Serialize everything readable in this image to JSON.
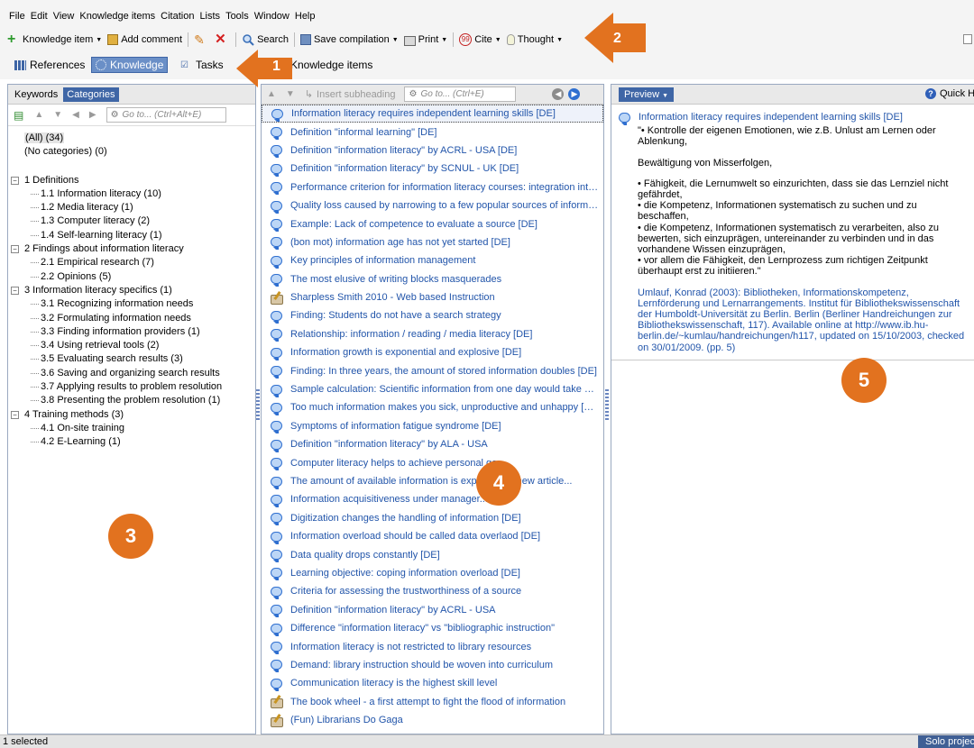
{
  "menu": [
    "File",
    "Edit",
    "View",
    "Knowledge items",
    "Citation",
    "Lists",
    "Tools",
    "Window",
    "Help"
  ],
  "toolbar": {
    "knowledge_item": "Knowledge item",
    "add_comment": "Add comment",
    "search": "Search",
    "save_compilation": "Save compilation",
    "print": "Print",
    "cite": "Cite",
    "thought": "Thought"
  },
  "nav": {
    "references": "References",
    "knowledge": "Knowledge",
    "tasks": "Tasks",
    "pane_title": "Knowledge items"
  },
  "left": {
    "tabs": [
      "Keywords",
      "Categories"
    ],
    "goto_placeholder": "Go to... (Ctrl+Alt+E)",
    "all": "(All) (34)",
    "none": "(No categories) (0)",
    "groups": [
      {
        "label": "1 Definitions",
        "items": [
          "1.1 Information literacy (10)",
          "1.2 Media literacy (1)",
          "1.3 Computer literacy (2)",
          "1.4 Self-learning literacy (1)"
        ]
      },
      {
        "label": "2 Findings about information literacy",
        "items": [
          "2.1 Empirical research (7)",
          "2.2 Opinions (5)"
        ]
      },
      {
        "label": "3 Information literacy specifics (1)",
        "items": [
          "3.1 Recognizing information needs",
          "3.2 Formulating information needs",
          "3.3 Finding information providers (1)",
          "3.4 Using retrieval tools (2)",
          "3.5 Evaluating search results (3)",
          "3.6 Saving and organizing search results",
          "3.7 Applying results to problem resolution",
          "3.8 Presenting the problem resolution (1)"
        ]
      },
      {
        "label": "4 Training methods (3)",
        "items": [
          "4.1 On-site training",
          "4.2 E-Learning (1)"
        ]
      }
    ]
  },
  "mid": {
    "insert_subheading": "Insert subheading",
    "goto_placeholder": "Go to... (Ctrl+E)",
    "items": [
      "Information literacy requires independent learning skills [DE]",
      "Definition \"informal learning\" [DE]",
      "Definition \"information literacy\" by ACRL - USA [DE]",
      "Definition \"information literacy\" by SCNUL - UK [DE]",
      "Performance criterion for information literacy courses: integration into c...",
      "Quality loss caused by narrowing to a few popular sources of informatio...",
      "Example: Lack of competence to evaluate a source [DE]",
      "(bon mot) information age has not yet started [DE]",
      "Key principles of information management",
      "The most elusive of writing blocks masquerades",
      "Sharpless Smith 2010 - Web based Instruction",
      "Finding: Students do not have a search strategy",
      "Relationship: information / reading / media literacy [DE]",
      "Information growth is exponential and explosive [DE]",
      "Finding: In three years, the amount of stored information doubles [DE]",
      "Sample calculation: Scientific information from one day would take 1.5...",
      "Too much information makes you sick, unproductive and unhappy [DE]",
      "Symptoms of information fatigue syndrome [DE]",
      "Definition \"information literacy\" by ALA - USA",
      "Computer literacy helps to achieve personal go...",
      "The amount of available information is expl...  ...lion new article...",
      "Information acquisitiveness under manager...",
      "Digitization changes the handling of information [DE]",
      "Information overload should be called data overlaod [DE]",
      "Data quality drops constantly [DE]",
      "Learning objective: coping information overload [DE]",
      "Criteria for assessing the trustworthiness of a source",
      "Definition \"information literacy\" by ACRL - USA",
      "Difference \"information literacy\" vs \"bibliographic instruction\"",
      "Information literacy is not restricted to library resources",
      "Demand: library instruction should be woven into curriculum",
      "Communication literacy is the highest skill level",
      "The book wheel - a first attempt to fight the flood of information",
      "(Fun) Librarians Do Gaga"
    ]
  },
  "right": {
    "preview": "Preview",
    "quick_help": "Quick Help",
    "title": "Information literacy requires independent learning skills [DE]",
    "p1": "\"• Kontrolle der eigenen Emotionen, wie z.B. Unlust am Lernen oder Ablenkung,",
    "p2": "Bewältigung von Misserfolgen,",
    "p3": "• Fähigkeit, die Lernumwelt so einzurichten, dass sie das Lernziel nicht gefährdet,\n• die Kompetenz, Informationen systematisch zu suchen und zu beschaffen,\n• die Kompetenz, Informationen systematisch zu verarbeiten, also zu bewerten, sich einzuprägen, untereinander zu verbinden und in das vorhandene Wissen einzuprägen,\n• vor allem die Fähigkeit, den Lernprozess zum richtigen Zeitpunkt überhaupt erst zu initiieren.\"",
    "source": "Umlauf, Konrad (2003): Bibliotheken, Informationskompetenz, Lernförderung und Lernarrangements. Institut für Bibliothekswissenschaft der Humboldt-Universität zu Berlin. Berlin (Berliner Handreichungen zur Bibliothekswissenschaft, 117). Available online at http://www.ib.hu-berlin.de/~kumlau/handreichungen/h117, updated on 15/10/2003, checked on 30/01/2009. (pp. 5)"
  },
  "status": {
    "selected": "1 selected",
    "solo": "Solo project"
  },
  "markers": [
    "1",
    "2",
    "3",
    "4",
    "5"
  ],
  "colors": {
    "accent": "#3f66a6",
    "marker": "#e2721f",
    "link": "#2255aa"
  }
}
